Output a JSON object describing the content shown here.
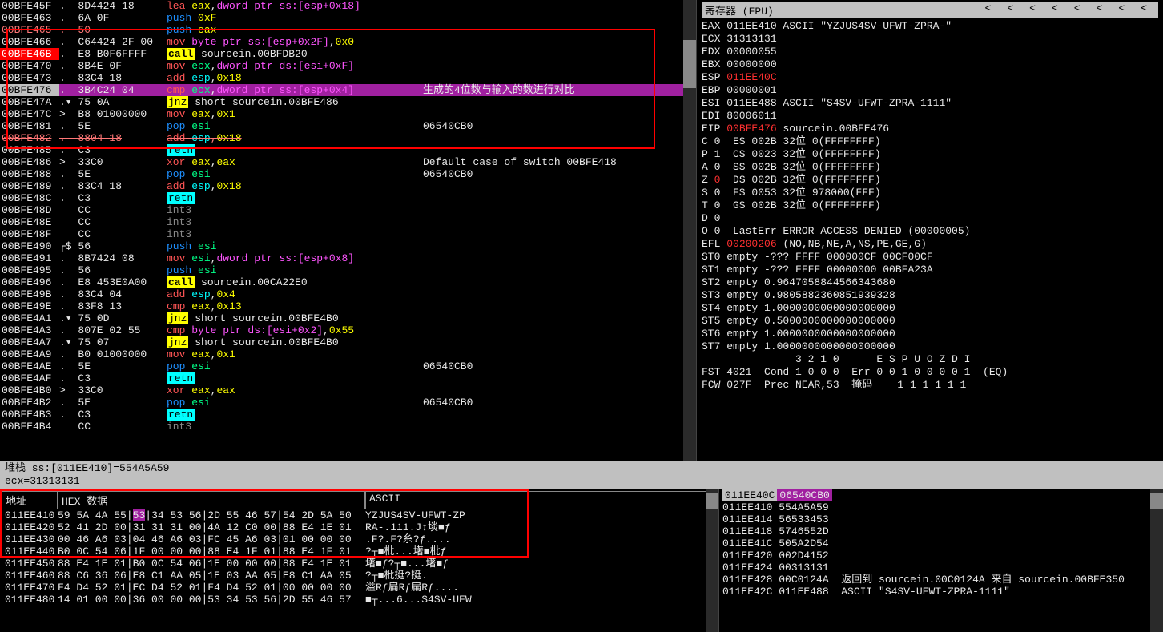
{
  "disasm": {
    "rows": [
      {
        "addr": "00BFE45F",
        "bytes": ".  8D4424 18",
        "asm": [
          {
            "t": "lea",
            "c": "op-lea"
          },
          {
            "t": " "
          },
          {
            "t": "eax",
            "c": "reg-y"
          },
          {
            "t": ","
          },
          {
            "t": "dword ptr ss:[esp+0x18]",
            "c": "reg-m"
          }
        ],
        "cmt": ""
      },
      {
        "addr": "00BFE463",
        "bytes": ".  6A 0F",
        "asm": [
          {
            "t": "push",
            "c": "op-push"
          },
          {
            "t": " "
          },
          {
            "t": "0xF",
            "c": "num"
          }
        ],
        "cmt": ""
      },
      {
        "addr": "00BFE465",
        "bytes": ".  50",
        "asm": [
          {
            "t": "push",
            "c": "op-push"
          },
          {
            "t": " "
          },
          {
            "t": "eax",
            "c": "reg-y"
          }
        ],
        "cmt": "",
        "strike": true
      },
      {
        "addr": "00BFE466",
        "bytes": ".  C64424 2F 00",
        "asm": [
          {
            "t": "mov",
            "c": "op-mov"
          },
          {
            "t": " "
          },
          {
            "t": "byte ptr ss:[esp+0x2F]",
            "c": "reg-m"
          },
          {
            "t": ","
          },
          {
            "t": "0x0",
            "c": "num"
          }
        ],
        "cmt": ""
      },
      {
        "addr": "00BFE46B",
        "bytes": ".  E8 B0F6FFFF",
        "asm": [
          {
            "t": "call",
            "c": "op-call"
          },
          {
            "t": " sourcein.00BFDB20"
          }
        ],
        "cmt": "",
        "addrStyle": "addr-red"
      },
      {
        "addr": "00BFE470",
        "bytes": ".  8B4E 0F",
        "asm": [
          {
            "t": "mov",
            "c": "op-mov"
          },
          {
            "t": " "
          },
          {
            "t": "ecx",
            "c": "reg-r"
          },
          {
            "t": ","
          },
          {
            "t": "dword ptr ds:[esi+0xF]",
            "c": "reg-m"
          }
        ],
        "cmt": ""
      },
      {
        "addr": "00BFE473",
        "bytes": ".  83C4 18",
        "asm": [
          {
            "t": "add",
            "c": "op-add"
          },
          {
            "t": " "
          },
          {
            "t": "esp",
            "c": "reg-c"
          },
          {
            "t": ","
          },
          {
            "t": "0x18",
            "c": "num"
          }
        ],
        "cmt": ""
      },
      {
        "addr": "00BFE476",
        "bytes": ".  3B4C24 04",
        "asm": [
          {
            "t": "cmp",
            "c": "op-cmp"
          },
          {
            "t": " "
          },
          {
            "t": "ecx",
            "c": "reg-r"
          },
          {
            "t": ","
          },
          {
            "t": "dword ptr ss:[esp+0x4]",
            "c": "reg-m"
          }
        ],
        "cmt": "生成的4位数与输入的数进行对比",
        "addrStyle": "addr-gray",
        "rowClass": "hl-row"
      },
      {
        "addr": "00BFE47A",
        "bytes": ".▾ 75 0A",
        "asm": [
          {
            "t": "jnz",
            "c": "op-jnz"
          },
          {
            "t": " short sourcein.00BFE486"
          }
        ],
        "cmt": ""
      },
      {
        "addr": "00BFE47C",
        "bytes": ">  B8 01000000",
        "asm": [
          {
            "t": "mov",
            "c": "op-mov"
          },
          {
            "t": " "
          },
          {
            "t": "eax",
            "c": "reg-y"
          },
          {
            "t": ","
          },
          {
            "t": "0x1",
            "c": "num"
          }
        ],
        "cmt": ""
      },
      {
        "addr": "00BFE481",
        "bytes": ".  5E",
        "asm": [
          {
            "t": "pop",
            "c": "op-pop"
          },
          {
            "t": " "
          },
          {
            "t": "esi",
            "c": "reg-r"
          }
        ],
        "cmt": "06540CB0"
      },
      {
        "addr": "00BFE482",
        "bytes": ".  8804 18",
        "asm": [
          {
            "t": "add",
            "c": "op-add"
          },
          {
            "t": " "
          },
          {
            "t": "esp",
            "c": "reg-c"
          },
          {
            "t": ","
          },
          {
            "t": "0x18",
            "c": "num"
          }
        ],
        "cmt": "",
        "strike": true
      },
      {
        "addr": "00BFE485",
        "bytes": ".  C3",
        "asm": [
          {
            "t": "retn",
            "c": "op-retn"
          }
        ],
        "cmt": ""
      },
      {
        "addr": "00BFE486",
        "bytes": ">  33C0",
        "asm": [
          {
            "t": "xor",
            "c": "op-xor"
          },
          {
            "t": " "
          },
          {
            "t": "eax",
            "c": "reg-y"
          },
          {
            "t": ","
          },
          {
            "t": "eax",
            "c": "reg-y"
          }
        ],
        "cmt": "Default case of switch 00BFE418"
      },
      {
        "addr": "00BFE488",
        "bytes": ".  5E",
        "asm": [
          {
            "t": "pop",
            "c": "op-pop"
          },
          {
            "t": " "
          },
          {
            "t": "esi",
            "c": "reg-r"
          }
        ],
        "cmt": "06540CB0"
      },
      {
        "addr": "00BFE489",
        "bytes": ".  83C4 18",
        "asm": [
          {
            "t": "add",
            "c": "op-add"
          },
          {
            "t": " "
          },
          {
            "t": "esp",
            "c": "reg-c"
          },
          {
            "t": ","
          },
          {
            "t": "0x18",
            "c": "num"
          }
        ],
        "cmt": ""
      },
      {
        "addr": "00BFE48C",
        "bytes": ".  C3",
        "asm": [
          {
            "t": "retn",
            "c": "op-retn"
          }
        ],
        "cmt": ""
      },
      {
        "addr": "00BFE48D",
        "bytes": "   CC",
        "asm": [
          {
            "t": "int3",
            "c": "op-int3"
          }
        ],
        "cmt": ""
      },
      {
        "addr": "00BFE48E",
        "bytes": "   CC",
        "asm": [
          {
            "t": "int3",
            "c": "op-int3"
          }
        ],
        "cmt": ""
      },
      {
        "addr": "00BFE48F",
        "bytes": "   CC",
        "asm": [
          {
            "t": "int3",
            "c": "op-int3"
          }
        ],
        "cmt": ""
      },
      {
        "addr": "00BFE490",
        "bytes": "┌$ 56",
        "asm": [
          {
            "t": "push",
            "c": "op-push"
          },
          {
            "t": " "
          },
          {
            "t": "esi",
            "c": "reg-r"
          }
        ],
        "cmt": ""
      },
      {
        "addr": "00BFE491",
        "bytes": ".  8B7424 08",
        "asm": [
          {
            "t": "mov",
            "c": "op-mov"
          },
          {
            "t": " "
          },
          {
            "t": "esi",
            "c": "reg-r"
          },
          {
            "t": ","
          },
          {
            "t": "dword ptr ss:[esp+0x8]",
            "c": "reg-m"
          }
        ],
        "cmt": ""
      },
      {
        "addr": "00BFE495",
        "bytes": ".  56",
        "asm": [
          {
            "t": "push",
            "c": "op-push"
          },
          {
            "t": " "
          },
          {
            "t": "esi",
            "c": "reg-r"
          }
        ],
        "cmt": ""
      },
      {
        "addr": "00BFE496",
        "bytes": ".  E8 453E0A00",
        "asm": [
          {
            "t": "call",
            "c": "op-call"
          },
          {
            "t": " sourcein.00CA22E0"
          }
        ],
        "cmt": ""
      },
      {
        "addr": "00BFE49B",
        "bytes": ".  83C4 04",
        "asm": [
          {
            "t": "add",
            "c": "op-add"
          },
          {
            "t": " "
          },
          {
            "t": "esp",
            "c": "reg-c"
          },
          {
            "t": ","
          },
          {
            "t": "0x4",
            "c": "num"
          }
        ],
        "cmt": ""
      },
      {
        "addr": "00BFE49E",
        "bytes": ".  83F8 13",
        "asm": [
          {
            "t": "cmp",
            "c": "op-cmp"
          },
          {
            "t": " "
          },
          {
            "t": "eax",
            "c": "reg-y"
          },
          {
            "t": ","
          },
          {
            "t": "0x13",
            "c": "num"
          }
        ],
        "cmt": ""
      },
      {
        "addr": "00BFE4A1",
        "bytes": ".▾ 75 0D",
        "asm": [
          {
            "t": "jnz",
            "c": "op-jnz"
          },
          {
            "t": " short sourcein.00BFE4B0"
          }
        ],
        "cmt": ""
      },
      {
        "addr": "00BFE4A3",
        "bytes": ".  807E 02 55",
        "asm": [
          {
            "t": "cmp",
            "c": "op-cmp"
          },
          {
            "t": " "
          },
          {
            "t": "byte ptr ds:[esi+0x2]",
            "c": "reg-m"
          },
          {
            "t": ","
          },
          {
            "t": "0x55",
            "c": "num"
          }
        ],
        "cmt": ""
      },
      {
        "addr": "00BFE4A7",
        "bytes": ".▾ 75 07",
        "asm": [
          {
            "t": "jnz",
            "c": "op-jnz"
          },
          {
            "t": " short sourcein.00BFE4B0"
          }
        ],
        "cmt": ""
      },
      {
        "addr": "00BFE4A9",
        "bytes": ".  B0 01000000",
        "asm": [
          {
            "t": "mov",
            "c": "op-mov"
          },
          {
            "t": " "
          },
          {
            "t": "eax",
            "c": "reg-y"
          },
          {
            "t": ","
          },
          {
            "t": "0x1",
            "c": "num"
          }
        ],
        "cmt": ""
      },
      {
        "addr": "00BFE4AE",
        "bytes": ".  5E",
        "asm": [
          {
            "t": "pop",
            "c": "op-pop"
          },
          {
            "t": " "
          },
          {
            "t": "esi",
            "c": "reg-r"
          }
        ],
        "cmt": "06540CB0"
      },
      {
        "addr": "00BFE4AF",
        "bytes": ".  C3",
        "asm": [
          {
            "t": "retn",
            "c": "op-retn"
          }
        ],
        "cmt": ""
      },
      {
        "addr": "00BFE4B0",
        "bytes": ">  33C0",
        "asm": [
          {
            "t": "xor",
            "c": "op-xor"
          },
          {
            "t": " "
          },
          {
            "t": "eax",
            "c": "reg-y"
          },
          {
            "t": ","
          },
          {
            "t": "eax",
            "c": "reg-y"
          }
        ],
        "cmt": ""
      },
      {
        "addr": "00BFE4B2",
        "bytes": ".  5E",
        "asm": [
          {
            "t": "pop",
            "c": "op-pop"
          },
          {
            "t": " "
          },
          {
            "t": "esi",
            "c": "reg-r"
          }
        ],
        "cmt": "06540CB0"
      },
      {
        "addr": "00BFE4B3",
        "bytes": ".  C3",
        "asm": [
          {
            "t": "retn",
            "c": "op-retn"
          }
        ],
        "cmt": ""
      },
      {
        "addr": "00BFE4B4",
        "bytes": "   CC",
        "asm": [
          {
            "t": "int3",
            "c": "op-int3"
          }
        ],
        "cmt": ""
      }
    ]
  },
  "registers": {
    "title": "寄存器 (FPU)",
    "lines": [
      "EAX 011EE410 ASCII \"YZJUS4SV-UFWT-ZPRA-\"",
      "ECX 31313131",
      "EDX 00000055",
      "EBX 00000000",
      "ESP §011EE40C",
      "EBP 00000001",
      "ESI 011EE488 ASCII \"S4SV-UFWT-ZPRA-1111\"",
      "EDI 80006011",
      "",
      "EIP §00BFE476 sourcein.00BFE476",
      "",
      "C 0  ES 002B 32位 0(FFFFFFFF)",
      "P 1  CS 0023 32位 0(FFFFFFFF)",
      "A 0  SS 002B 32位 0(FFFFFFFF)",
      "Z §0  DS 002B 32位 0(FFFFFFFF)",
      "S 0  FS 0053 32位 978000(FFF)",
      "T 0  GS 002B 32位 0(FFFFFFFF)",
      "D 0",
      "O 0  LastErr ERROR_ACCESS_DENIED (00000005)",
      "",
      "EFL §00200206 (NO,NB,NE,A,NS,PE,GE,G)",
      "",
      "ST0 empty -??? FFFF 000000CF 00CF00CF",
      "ST1 empty -??? FFFF 00000000 00BFA23A",
      "ST2 empty 0.9647058844566343680",
      "ST3 empty 0.9805882360851939328",
      "ST4 empty 1.0000000000000000000",
      "ST5 empty 0.5000000000000000000",
      "ST6 empty 1.0000000000000000000",
      "ST7 empty 1.0000000000000000000",
      "               3 2 1 0      E S P U O Z D I",
      "FST 4021  Cond 1 0 0 0  Err 0 0 1 0 0 0 0 1  (EQ)",
      "FCW 027F  Prec NEAR,53  掩码    1 1 1 1 1 1"
    ]
  },
  "info": {
    "line1": "堆栈 ss:[011EE410]=554A5A59",
    "line2": "ecx=31313131"
  },
  "hex": {
    "headers": {
      "addr": "地址",
      "hex": "HEX 数据",
      "ascii": "ASCII"
    },
    "rows": [
      {
        "a": "011EE410",
        "h": "59 5A 4A 55|§53|34 53 56|2D 55 46 57|54 2D 5A 50",
        "s": "YZJUS4SV-UFWT-ZP"
      },
      {
        "a": "011EE420",
        "h": "52 41 2D 00|31 31 31 00|4A 12 C0 00|88 E4 1E 01",
        "s": "RA-.111.J↕埮■ƒ"
      },
      {
        "a": "011EE430",
        "h": "00 46 A6 03|04 46 A6 03|FC 45 A6 03|01 00 00 00",
        "s": ".F?.F?糸?ƒ...."
      },
      {
        "a": "011EE440",
        "h": "B0 0C 54 06|1F 00 00 00|88 E4 1F 01|88 E4 1F 01",
        "s": "?┬■枇...墸■枇ƒ"
      },
      {
        "a": "011EE450",
        "h": "88 E4 1E 01|B0 0C 54 06|1E 00 00 00|88 E4 1E 01",
        "s": "墸■ƒ?┬■...墸■ƒ"
      },
      {
        "a": "011EE460",
        "h": "88 C6 36 06|E8 C1 AA 05|1E 03 AA 05|E8 C1 AA 05",
        "s": "?┬■枇挺?挺."
      },
      {
        "a": "011EE470",
        "h": "F4 D4 52 01|EC D4 52 01|F4 D4 52 01|00 00 00 00",
        "s": "溢Rƒ扁Rƒ扁Rƒ...."
      },
      {
        "a": "011EE480",
        "h": "14 01 00 00|36 00 00 00|53 34 53 56|2D 55 46 57",
        "s": "■┬...6...S4SV-UFW"
      }
    ]
  },
  "stack": {
    "rows": [
      {
        "a": "011EE40C",
        "v": "06540CB0",
        "hl": true
      },
      {
        "a": "011EE410",
        "v": "554A5A59"
      },
      {
        "a": "011EE414",
        "v": "56533453"
      },
      {
        "a": "011EE418",
        "v": "5746552D"
      },
      {
        "a": "011EE41C",
        "v": "505A2D54"
      },
      {
        "a": "011EE420",
        "v": "002D4152"
      },
      {
        "a": "011EE424",
        "v": "00313131"
      },
      {
        "a": "011EE428",
        "v": "00C0124A",
        "c": "返回到 sourcein.00C0124A 来自 sourcein.00BFE350"
      },
      {
        "a": "011EE42C",
        "v": "011EE488",
        "c": "ASCII \"S4SV-UFWT-ZPRA-1111\""
      }
    ]
  }
}
